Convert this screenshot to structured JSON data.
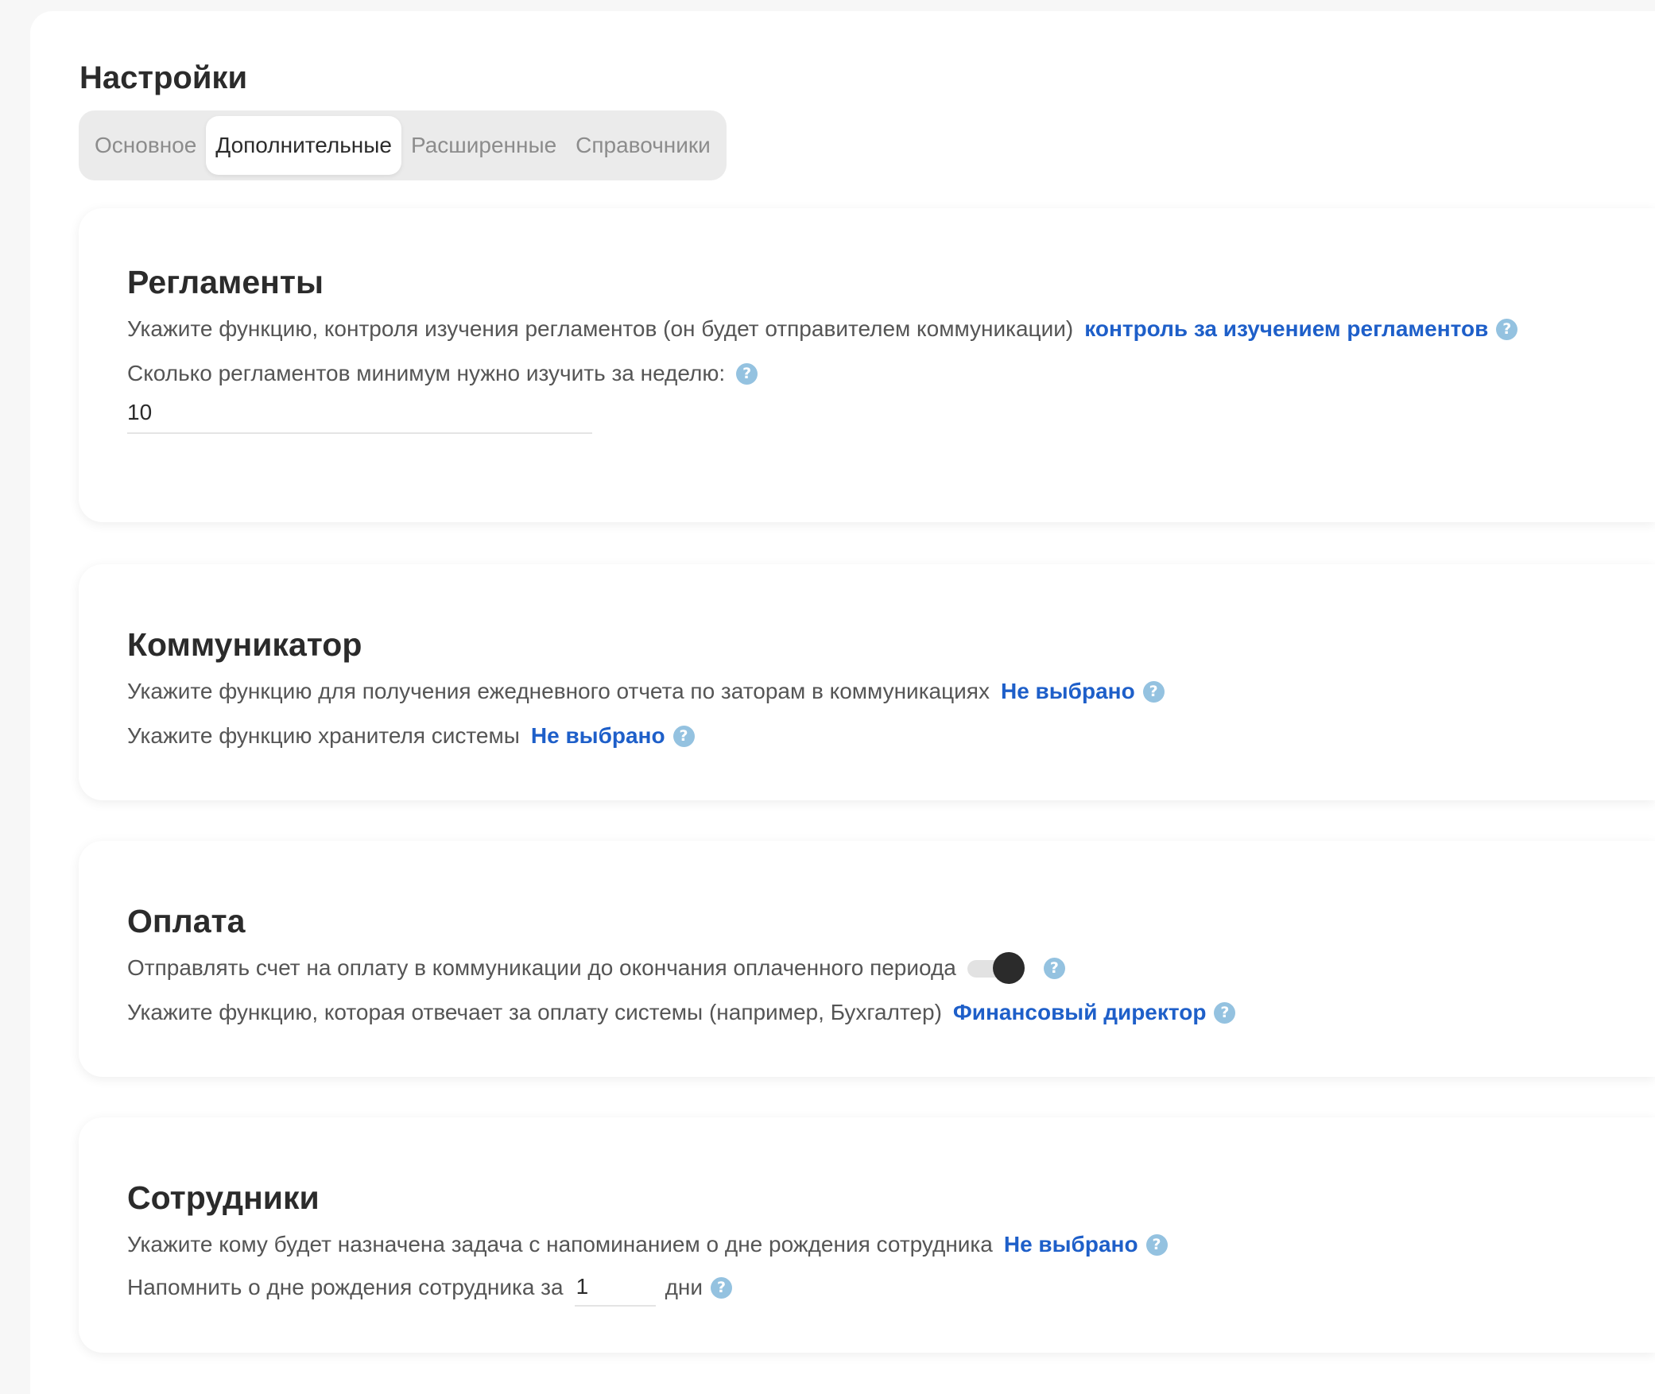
{
  "page": {
    "title": "Настройки"
  },
  "tabs": [
    {
      "label": "Основное",
      "active": false
    },
    {
      "label": "Дополнительные",
      "active": true
    },
    {
      "label": "Расширенные",
      "active": false
    },
    {
      "label": "Справочники",
      "active": false
    }
  ],
  "reglaments": {
    "title": "Регламенты",
    "function_label": "Укажите функцию, контроля изучения регламентов (он будет отправителем коммуникации)",
    "function_value": "контроль за изучением регламентов",
    "min_label": "Сколько регламентов минимум нужно изучить за неделю:",
    "min_value": "10"
  },
  "communicator": {
    "title": "Коммуникатор",
    "report_label": "Укажите функцию для получения ежедневного отчета по заторам в коммуникациях",
    "report_value": "Не выбрано",
    "keeper_label": "Укажите функцию хранителя системы",
    "keeper_value": "Не выбрано"
  },
  "payment": {
    "title": "Оплата",
    "invoice_label": "Отправлять счет на оплату в коммуникации до окончания оплаченного периода",
    "invoice_enabled": true,
    "function_label": "Укажите функцию, которая отвечает за оплату системы (например, Бухгалтер)",
    "function_value": "Финансовый директор"
  },
  "employees": {
    "title": "Сотрудники",
    "assignee_label": "Укажите кому будет назначена задача с напоминанием о дне рождения сотрудника",
    "assignee_value": "Не выбрано",
    "remind_label": "Напомнить о дне рождения сотрудника за",
    "remind_value": "1",
    "remind_unit": "дни"
  },
  "help_glyph": "?",
  "colors": {
    "link": "#1e5fc9",
    "help": "#94c2e0",
    "toggle_on": "#2b2b2b"
  }
}
